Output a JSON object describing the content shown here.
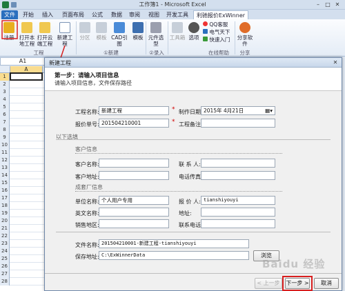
{
  "window": {
    "title": "工作簿1 - Microsoft Excel"
  },
  "tabs": [
    "文件",
    "开始",
    "插入",
    "页面布局",
    "公式",
    "数据",
    "审阅",
    "视图",
    "开发工具",
    "利驰报价ExWinner"
  ],
  "ribbon": {
    "buttons": {
      "register": "注册",
      "open_project": "打开本地工程",
      "open_cloud": "打开云端工程",
      "new_project": "新建工程",
      "split": "分区",
      "module": "模板",
      "cad": "CAD引图",
      "template": "模板",
      "component": "元件选型",
      "toolbox": "工具箱",
      "options": "选项",
      "qq": "QQ客服",
      "telecom": "电气天下",
      "quick_start": "快速入门",
      "share": "分享软件"
    },
    "groups": {
      "project": "工程",
      "new": "①新建",
      "input": "②录入",
      "online": "在线帮助",
      "share": "分享"
    }
  },
  "sheet": {
    "name_box": "A1",
    "column": "A",
    "rows": [
      "1",
      "2",
      "3",
      "4",
      "5",
      "6",
      "7",
      "8",
      "9",
      "10",
      "11",
      "12",
      "13",
      "14",
      "15",
      "16",
      "17",
      "18",
      "19",
      "20",
      "21",
      "22",
      "23",
      "24",
      "25",
      "26",
      "27",
      "28"
    ]
  },
  "dialog": {
    "title": "新建工程",
    "heading": "第一步：请输入项目信息",
    "subheading": "请输入项目信息，文件保存路径",
    "project_name_label": "工程名称:",
    "project_name": "新建工程",
    "date_label": "制作日期:",
    "date_value": "2015年 4月21日",
    "quote_no_label": "报价单号:",
    "quote_no": "201504210001",
    "remark_label": "工程备注:",
    "optional_label": "以下选填",
    "customer_section": "客户信息",
    "customer_name_label": "客户名称:",
    "contact_label": "联 系 人:",
    "customer_addr_label": "客户地址:",
    "phone_fax_label": "电话传真:",
    "factory_section": "成套厂信息",
    "unit_name_label": "单位名称:",
    "unit_name": "个人用户专用",
    "quoter_label": "报 价 人:",
    "quoter": "tianshiyouyi",
    "en_name_label": "英文名称:",
    "address_label": "地址:",
    "sales_region_label": "销售地区:",
    "contact_phone_label": "联系电话:",
    "file_name_label": "文件名称:",
    "file_name": "201504210001-新建工程-tianshiyouyi",
    "save_path_label": "保存地址:",
    "save_path": "C:\\ExWinnerData",
    "browse_button": "浏览",
    "prev_button": "< 上一步",
    "next_button": "下一步 >",
    "cancel_button": "取消"
  },
  "watermark": "Baidu 经验",
  "colors": {
    "excel_file_tab": "#2a6fbe",
    "highlight": "#d81e1e",
    "required": "#d00000"
  }
}
